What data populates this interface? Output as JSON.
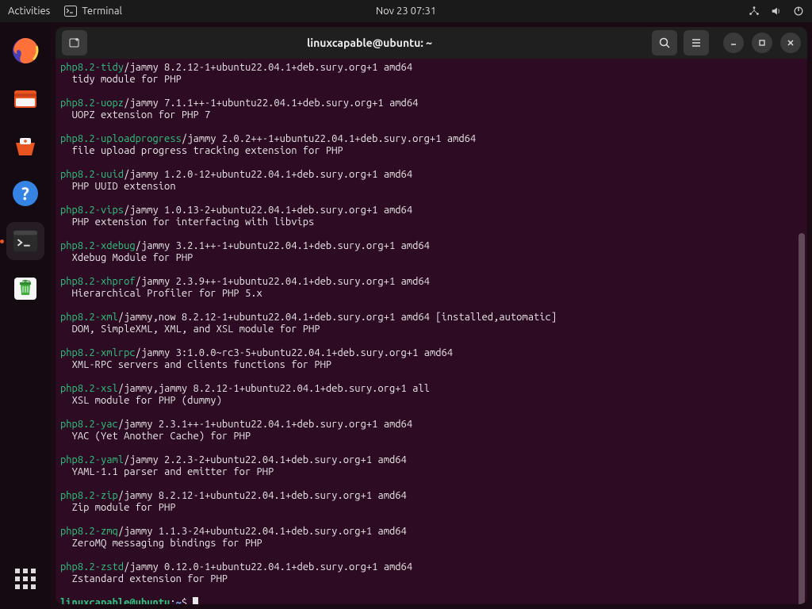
{
  "topbar": {
    "activities": "Activities",
    "app_label": "Terminal",
    "clock": "Nov 23  07:31"
  },
  "window": {
    "title": "linuxcapable@ubuntu: ~"
  },
  "packages": [
    {
      "name": "php8.2-tidy",
      "ver": "/jammy 8.2.12-1+ubuntu22.04.1+deb.sury.org+1 amd64",
      "desc": "tidy module for PHP"
    },
    {
      "name": "php8.2-uopz",
      "ver": "/jammy 7.1.1++-1+ubuntu22.04.1+deb.sury.org+1 amd64",
      "desc": "UOPZ extension for PHP 7"
    },
    {
      "name": "php8.2-uploadprogress",
      "ver": "/jammy 2.0.2++-1+ubuntu22.04.1+deb.sury.org+1 amd64",
      "desc": "file upload progress tracking extension for PHP"
    },
    {
      "name": "php8.2-uuid",
      "ver": "/jammy 1.2.0-12+ubuntu22.04.1+deb.sury.org+1 amd64",
      "desc": "PHP UUID extension"
    },
    {
      "name": "php8.2-vips",
      "ver": "/jammy 1.0.13-2+ubuntu22.04.1+deb.sury.org+1 amd64",
      "desc": "PHP extension for interfacing with libvips"
    },
    {
      "name": "php8.2-xdebug",
      "ver": "/jammy 3.2.1++-1+ubuntu22.04.1+deb.sury.org+1 amd64",
      "desc": "Xdebug Module for PHP"
    },
    {
      "name": "php8.2-xhprof",
      "ver": "/jammy 2.3.9++-1+ubuntu22.04.1+deb.sury.org+1 amd64",
      "desc": "Hierarchical Profiler for PHP 5.x"
    },
    {
      "name": "php8.2-xml",
      "ver": "/jammy,now 8.2.12-1+ubuntu22.04.1+deb.sury.org+1 amd64 [installed,automatic]",
      "desc": "DOM, SimpleXML, XML, and XSL module for PHP"
    },
    {
      "name": "php8.2-xmlrpc",
      "ver": "/jammy 3:1.0.0~rc3-5+ubuntu22.04.1+deb.sury.org+1 amd64",
      "desc": "XML-RPC servers and clients functions for PHP"
    },
    {
      "name": "php8.2-xsl",
      "ver": "/jammy,jammy 8.2.12-1+ubuntu22.04.1+deb.sury.org+1 all",
      "desc": "XSL module for PHP (dummy)"
    },
    {
      "name": "php8.2-yac",
      "ver": "/jammy 2.3.1++-1+ubuntu22.04.1+deb.sury.org+1 amd64",
      "desc": "YAC (Yet Another Cache) for PHP"
    },
    {
      "name": "php8.2-yaml",
      "ver": "/jammy 2.2.3-2+ubuntu22.04.1+deb.sury.org+1 amd64",
      "desc": "YAML-1.1 parser and emitter for PHP"
    },
    {
      "name": "php8.2-zip",
      "ver": "/jammy 8.2.12-1+ubuntu22.04.1+deb.sury.org+1 amd64",
      "desc": "Zip module for PHP"
    },
    {
      "name": "php8.2-zmq",
      "ver": "/jammy 1.1.3-24+ubuntu22.04.1+deb.sury.org+1 amd64",
      "desc": "ZeroMQ messaging bindings for PHP"
    },
    {
      "name": "php8.2-zstd",
      "ver": "/jammy 0.12.0-1+ubuntu22.04.1+deb.sury.org+1 amd64",
      "desc": "Zstandard extension for PHP"
    }
  ],
  "prompt": {
    "userhost": "linuxcapable@ubuntu",
    "sep": ":",
    "path": "~",
    "symbol": "$"
  }
}
